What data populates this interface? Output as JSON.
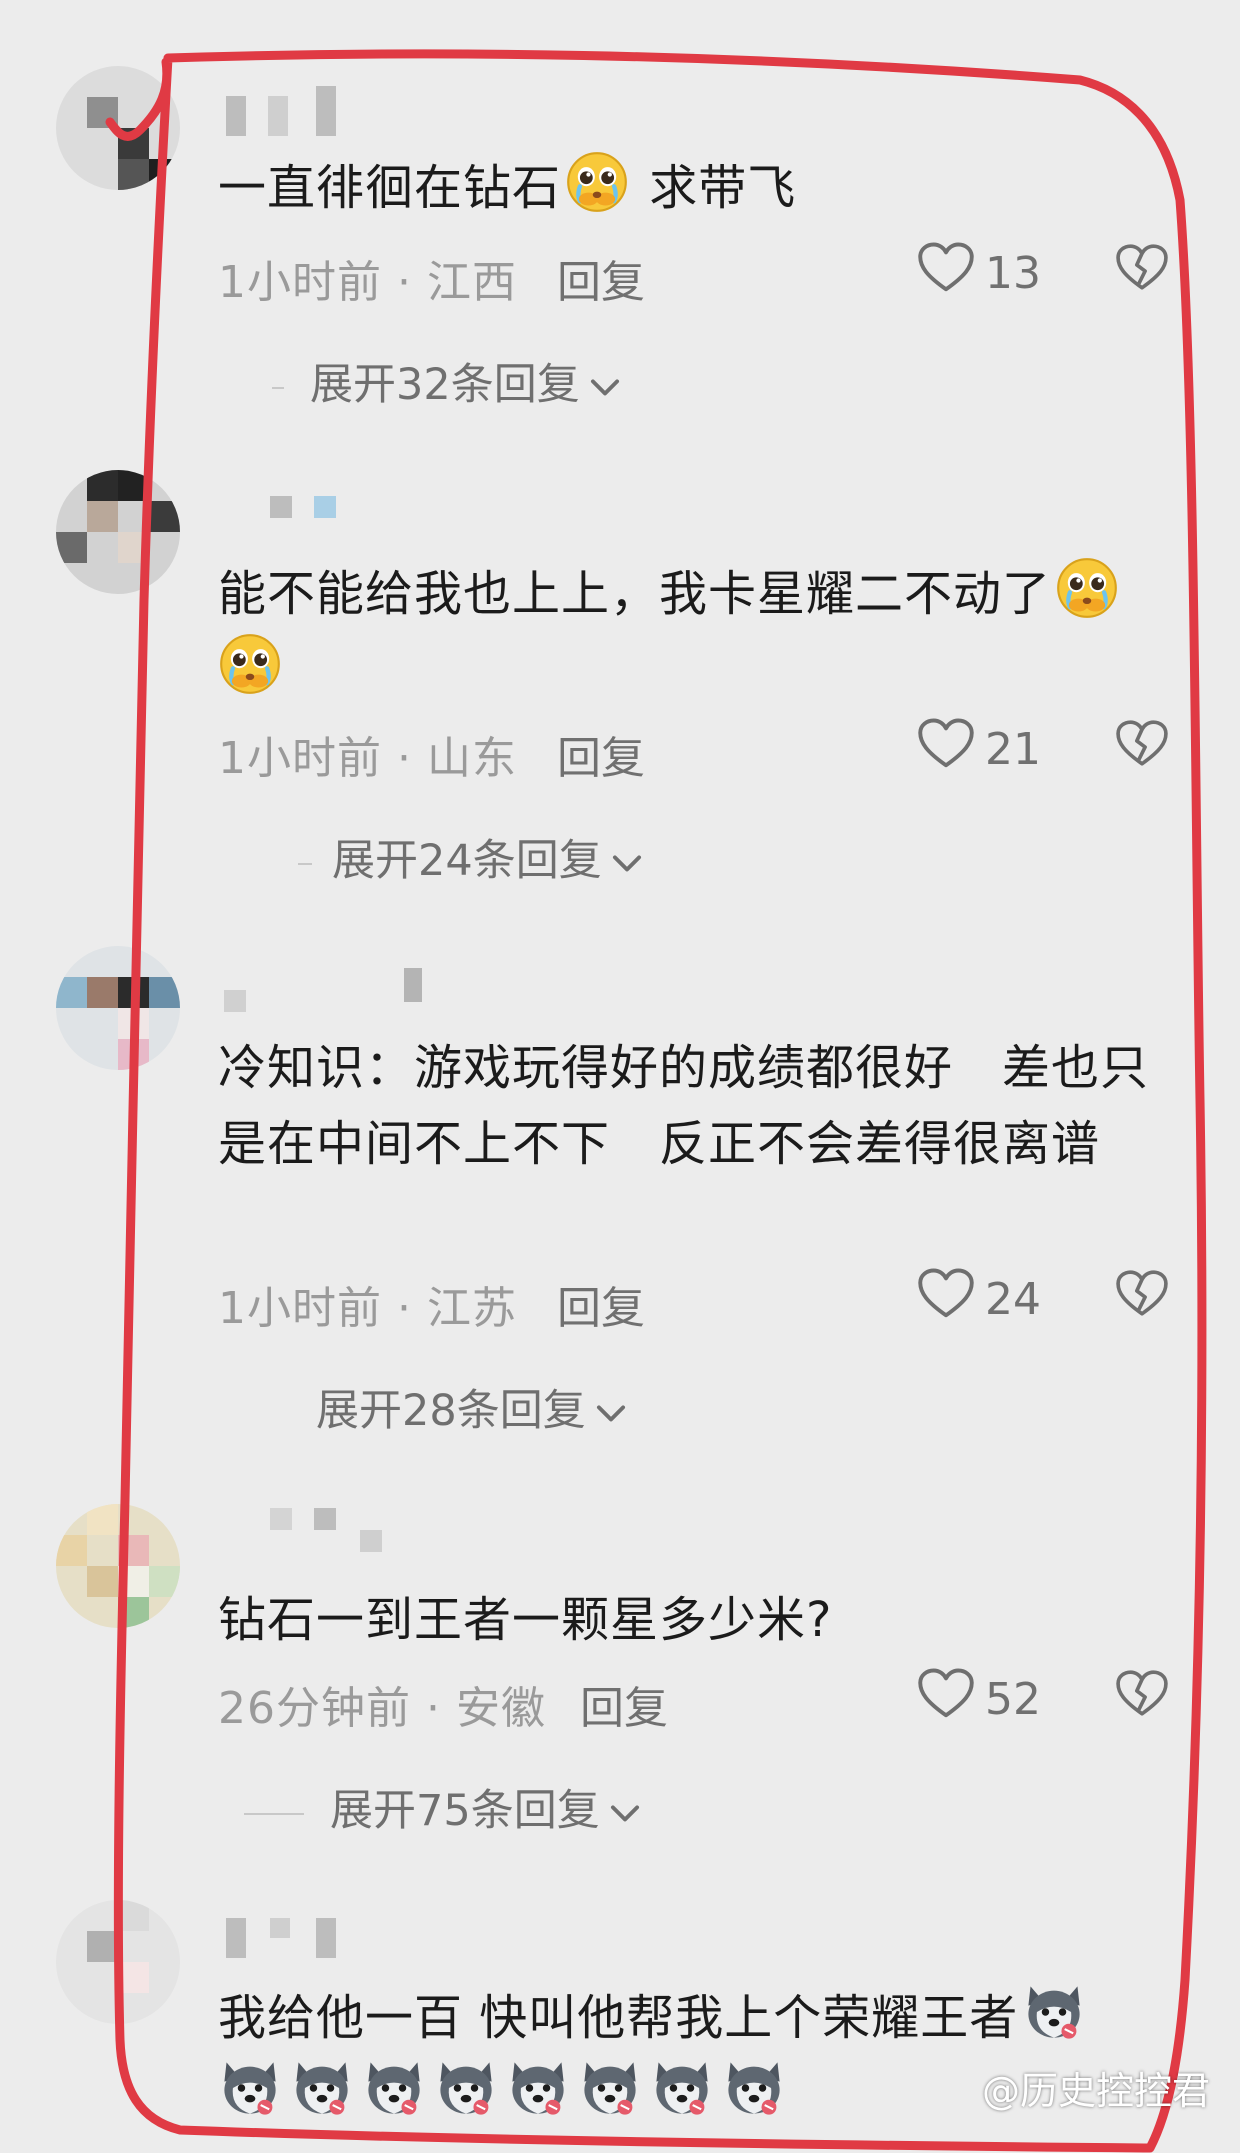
{
  "comments": [
    {
      "text": "一直徘徊在钻石",
      "text_after": " 求带飞",
      "time_location": "1小时前 · 江西",
      "reply_label": "回复",
      "likes": "13",
      "expand_label": "展开32条回复"
    },
    {
      "text": "能不能给我也上上，我卡星耀二不动了",
      "time_location": "1小时前 · 山东",
      "reply_label": "回复",
      "likes": "21",
      "expand_label": "展开24条回复"
    },
    {
      "text": "冷知识：游戏玩得好的成绩都很好　差也只是在中间不上不下　反正不会差得很离谱",
      "time_location": "1小时前 · 江苏",
      "reply_label": "回复",
      "likes": "24",
      "expand_label": "展开28条回复"
    },
    {
      "text": "钻石一到王者一颗星多少米?",
      "time_location": "26分钟前 · 安徽",
      "reply_label": "回复",
      "likes": "52",
      "expand_label": "展开75条回复"
    },
    {
      "text": "我给他一百 快叫他帮我上个荣耀王者"
    }
  ],
  "icons": {
    "like": "heart-outline-icon",
    "dislike": "broken-heart-icon",
    "expand": "chevron-down-icon",
    "emoji_a": "pleading-face-emoji",
    "emoji_b": "husky-dog-emoji"
  },
  "watermark": "@历史控控君",
  "colors": {
    "background": "#ececec",
    "annotation": "#e03a44",
    "meta_text": "#9a9a9a"
  }
}
